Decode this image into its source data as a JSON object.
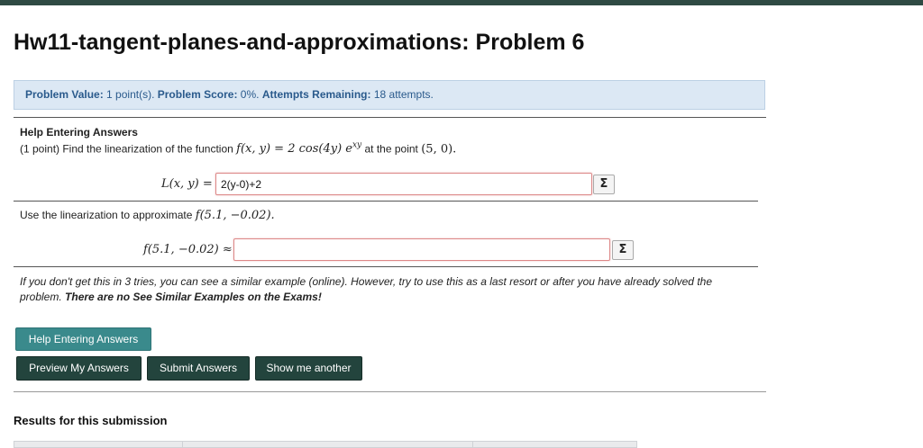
{
  "page": {
    "title": "Hw11-tangent-planes-and-approximations: Problem 6"
  },
  "info": {
    "problem_value_label": "Problem Value:",
    "problem_value": "1 point(s).",
    "problem_score_label": "Problem Score:",
    "problem_score": "0%.",
    "attempts_label": "Attempts Remaining:",
    "attempts": "18 attempts."
  },
  "problem": {
    "help_heading": "Help Entering Answers",
    "points": "(1 point) Find the linearization of the function",
    "function": "f(x, y) = 2 cos(4y) e",
    "exponent": "xy",
    "at_point_label": "at the point",
    "point": "(5, 0).",
    "answer1_label": "L(x, y) =",
    "answer1_value": "2(y-0)+2",
    "sub_question": "Use the linearization to approximate",
    "sub_expr": "f(5.1, −0.02).",
    "answer2_label": "f(5.1, −0.02) ≈",
    "answer2_value": "",
    "sigma": "Σ",
    "note_line": "If you don't get this in 3 tries, you can see a similar example (online). However, try to use this as a last resort or after you have already solved the problem.",
    "note_bold": "There are no See Similar Examples on the Exams!"
  },
  "buttons": {
    "help": "Help Entering Answers",
    "preview": "Preview My Answers",
    "submit": "Submit Answers",
    "another": "Show me another"
  },
  "results": {
    "title": "Results for this submission"
  },
  "colors": {
    "top_bar": "#2f4a43",
    "info_bg": "#dce8f4",
    "help_button": "#3a8a8c",
    "dark_button": "#23443d"
  }
}
